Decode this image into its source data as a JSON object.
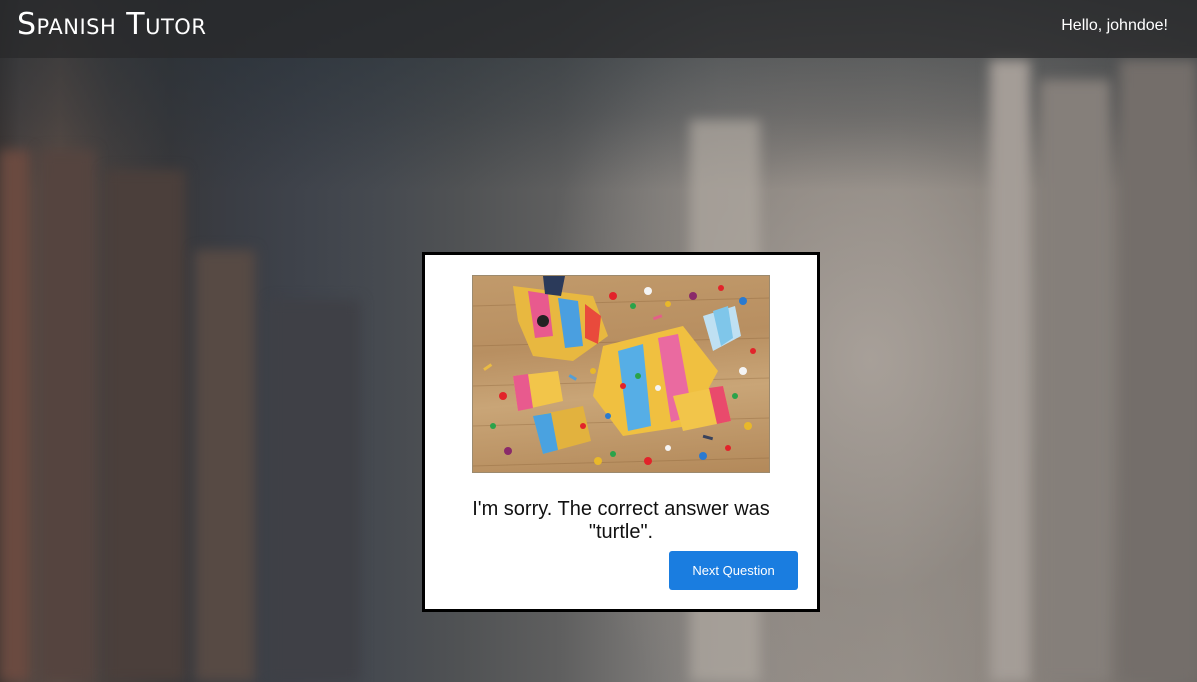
{
  "header": {
    "brand": "Spanish Tutor",
    "greeting": "Hello, johndoe!"
  },
  "feedback": {
    "message": "I'm sorry. The correct answer was \"turtle\".",
    "image_subject": "broken piñata with candy on wood floor",
    "next_button_label": "Next Question"
  },
  "colors": {
    "primary_button": "#1a7de0",
    "card_border": "#000000",
    "header_text": "#ffffff"
  }
}
